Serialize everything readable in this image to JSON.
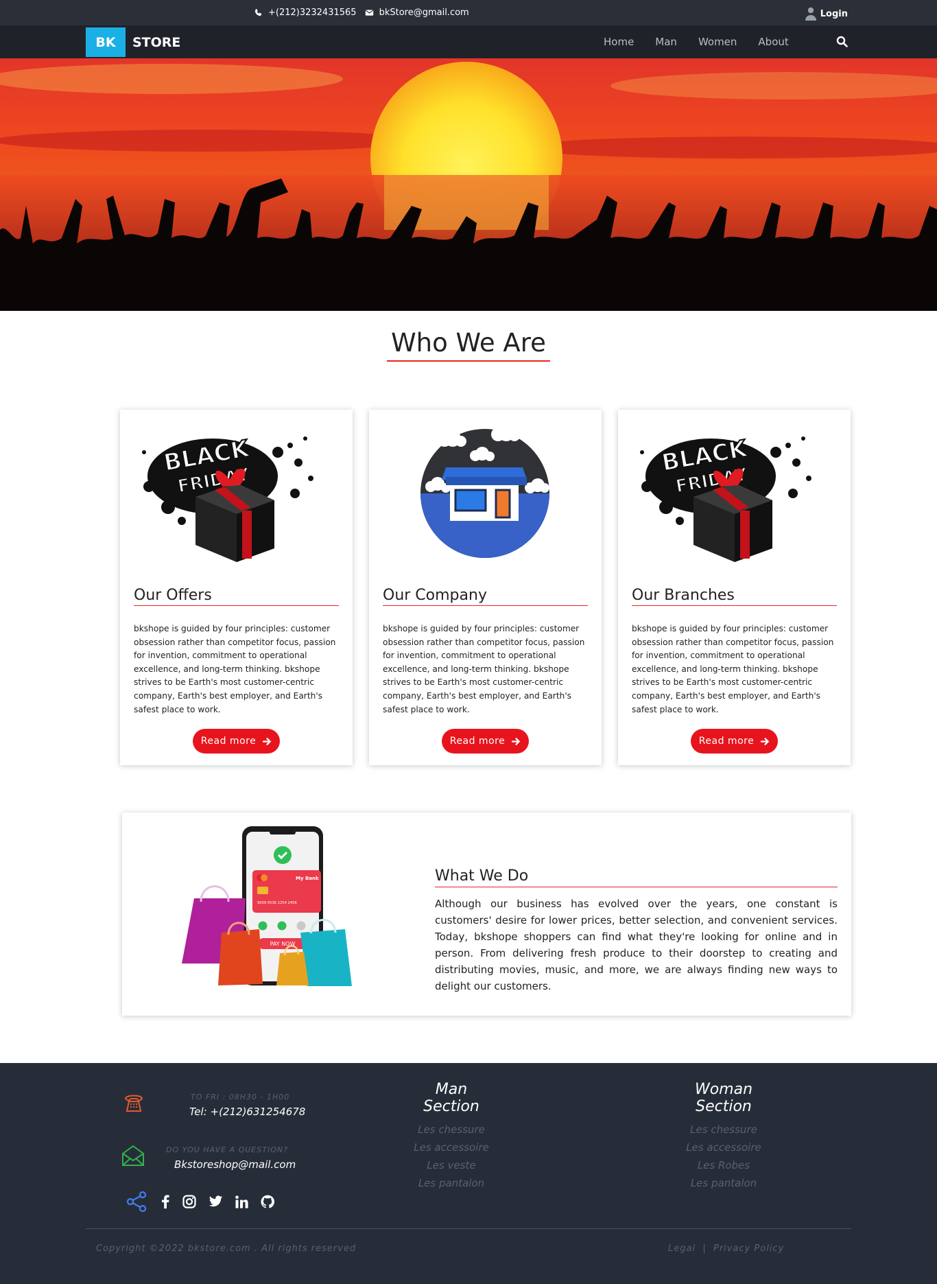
{
  "topbar": {
    "phone": "+(212)3232431565",
    "email": "bkStore@gmail.com",
    "login_label": "Login"
  },
  "navbar": {
    "brand_badge": "BK",
    "brand_text": "STORE",
    "links": [
      "Home",
      "Man",
      "Women",
      "About"
    ]
  },
  "about": {
    "title": "Who We Are",
    "cards": [
      {
        "title": "Our Offers",
        "text": "bkshope is guided by four principles: customer obsession rather than competitor focus, passion for invention, commitment to operational excellence, and long-term thinking. bkshope strives to be Earth's most customer-centric company, Earth's best employer, and Earth's safest place to work.",
        "button": "Read more"
      },
      {
        "title": "Our Company",
        "text": "bkshope is guided by four principles: customer obsession rather than competitor focus, passion for invention, commitment to operational excellence, and long-term thinking. bkshope strives to be Earth's most customer-centric company, Earth's best employer, and Earth's safest place to work.",
        "button": "Read more"
      },
      {
        "title": "Our Branches",
        "text": "bkshope is guided by four principles: customer obsession rather than competitor focus, passion for invention, commitment to operational excellence, and long-term thinking. bkshope strives to be Earth's most customer-centric company, Earth's best employer, and Earth's safest place to work.",
        "button": "Read more"
      }
    ],
    "badge_text": [
      "BLACK",
      "FRIDAY"
    ]
  },
  "what_we_do": {
    "title": "What We Do",
    "text": "Although our business has evolved over the years, one constant is customers' desire for lower prices, better selection, and convenient services. Today, bkshope shoppers can find what they're looking for online and in person. From delivering fresh produce to their doorstep to creating and distributing movies, music, and more, we are always finding new ways to delight our customers.",
    "phone_bank": "My Bank",
    "card_number": "9009 6536 1254 2456",
    "pay_label": "PAY NOW"
  },
  "footer": {
    "hours": "TO FRI : 08H30 - 1H00",
    "tel": "Tel: +(212)631254678",
    "question": "DO YOU HAVE A QUESTION?",
    "email": "Bkstoreshop@mail.com",
    "man_section": {
      "title": "Man Section",
      "items": [
        "Les chessure",
        "Les accessoire",
        "Les veste",
        "Les pantalon"
      ]
    },
    "woman_section": {
      "title": "Woman Section",
      "items": [
        "Les chessure",
        "Les accessoire",
        "Les Robes",
        "Les pantalon"
      ]
    },
    "copyright": "Copyright ©2022 bkstore.com . All rights reserved",
    "legal": "Legal",
    "separator": "|",
    "privacy": "Privacy Policy"
  },
  "colors": {
    "accent_red": "#e8141d",
    "brand_blue": "#1ab0e6",
    "footer_bg": "#272d38",
    "topbar_bg": "#2a2f38"
  },
  "icons": [
    "phone-icon",
    "envelope-icon",
    "user-icon",
    "search-icon",
    "arrow-right-icon",
    "share-icon",
    "facebook-icon",
    "instagram-icon",
    "twitter-icon",
    "linkedin-icon",
    "github-icon"
  ]
}
